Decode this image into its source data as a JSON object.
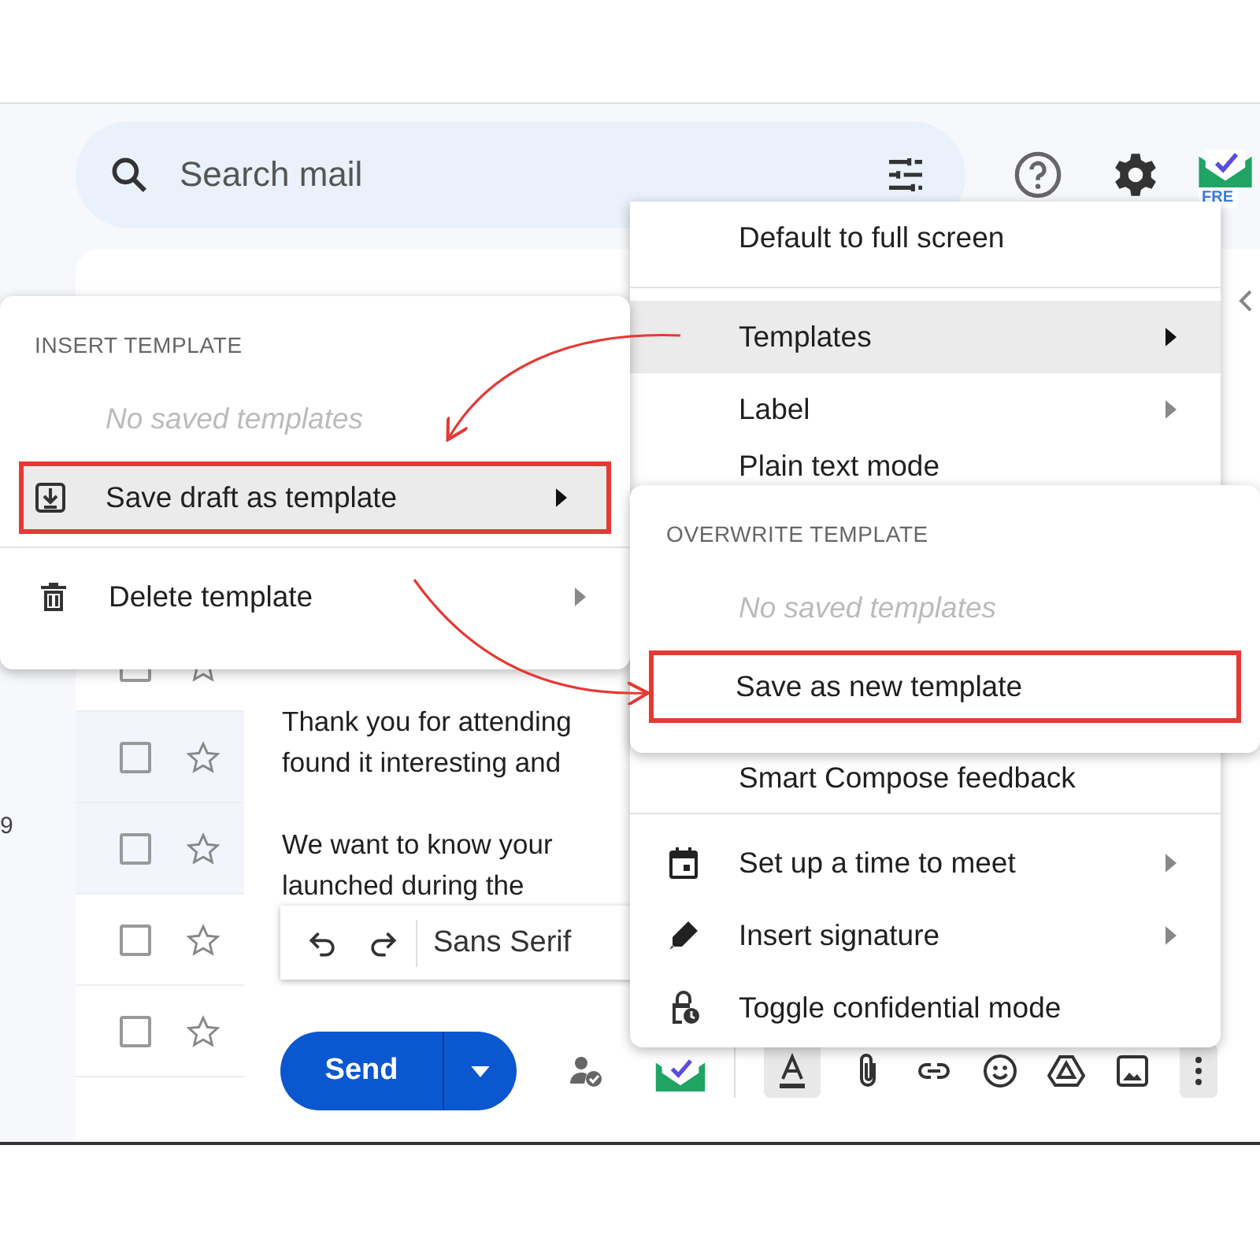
{
  "search": {
    "placeholder": "Search mail"
  },
  "app_badge": "FRE",
  "nav_count": "9",
  "inbox_rows": [
    {
      "read": false
    },
    {
      "read": true
    },
    {
      "read": true
    },
    {
      "read": false
    },
    {
      "read": false
    }
  ],
  "compose": {
    "body": [
      {
        "text": "Thank you for attending"
      },
      {
        "text": "found it interesting and"
      },
      {
        "text": "We want to know your"
      },
      {
        "text": "launched during the"
      }
    ],
    "font": "Sans Serif",
    "send": "Send"
  },
  "more_menu": {
    "sections": [
      [
        {
          "label": "Default to full screen",
          "submenu": false,
          "hovered": false,
          "marked": false
        }
      ],
      [
        {
          "label": "Templates",
          "submenu": true,
          "hovered": true,
          "marked": false
        },
        {
          "label": "Label",
          "submenu": true,
          "hovered": false,
          "marked": false
        },
        {
          "label": "Plain text mode",
          "submenu": false,
          "hovered": false,
          "marked": false
        },
        {
          "label": "Smart Compose feedback",
          "submenu": false,
          "hovered": false,
          "marked": false
        }
      ],
      [
        {
          "label": "Set up a time to meet",
          "submenu": true,
          "hovered": false,
          "marked": false
        },
        {
          "label": "Insert signature",
          "submenu": true,
          "hovered": false,
          "marked": false
        },
        {
          "label": "Toggle confidential mode",
          "submenu": false,
          "hovered": false,
          "marked": false
        }
      ]
    ]
  },
  "template_menu": {
    "heading": "INSERT TEMPLATE",
    "empty": "No saved templates",
    "items": [
      {
        "label": "Save draft as template",
        "submenu": true,
        "hovered": true,
        "marked": true
      },
      {
        "label": "Delete template",
        "submenu": true,
        "hovered": false,
        "marked": false
      }
    ]
  },
  "overwrite_menu": {
    "heading": "OVERWRITE TEMPLATE",
    "empty": "No saved templates",
    "items": [
      {
        "label": "Save as new template",
        "submenu": false,
        "hovered": false,
        "marked": true
      }
    ]
  }
}
